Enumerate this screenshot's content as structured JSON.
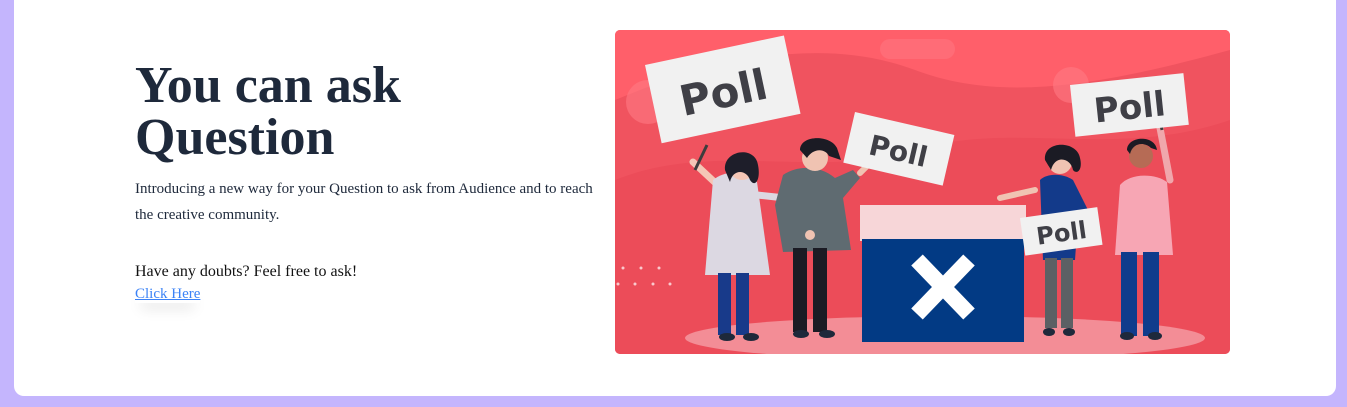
{
  "hero": {
    "title_line1": "You can ask",
    "title_line2": "Question",
    "description": "Introducing a new way for your Question to ask from Audience and to reach the creative community.",
    "doubts_text": "Have any doubts? Feel free to ask!",
    "link_label": "Click Here"
  },
  "illustration": {
    "sign_1": "Poll",
    "sign_2": "Poll",
    "sign_3": "Poll",
    "sign_4": "Poll"
  },
  "colors": {
    "page_background": "#c4b5fd",
    "illustration_background": "#f05562",
    "ballot_box": "#023a84",
    "link": "#3b82f6",
    "title": "#1e293b"
  }
}
